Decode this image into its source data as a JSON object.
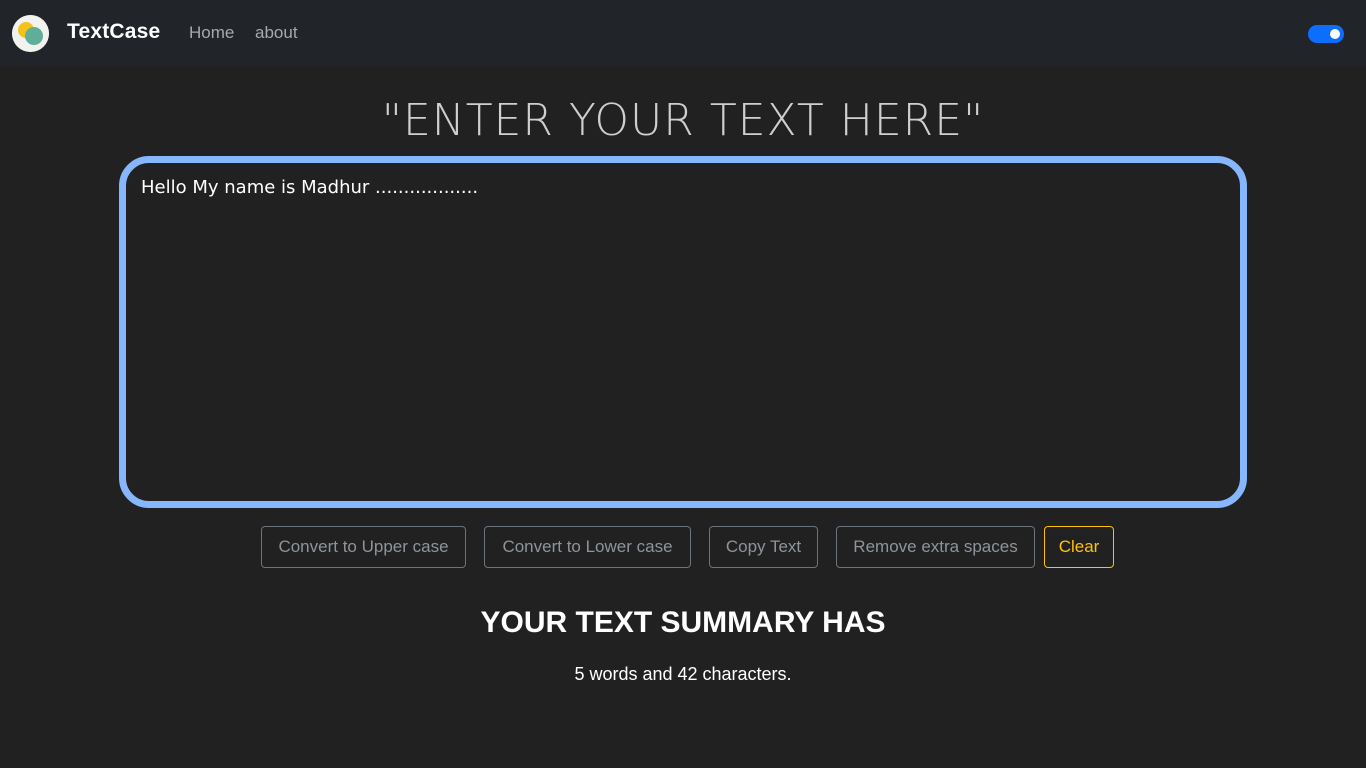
{
  "navbar": {
    "brand": "TextCase",
    "links": [
      {
        "label": "Home"
      },
      {
        "label": "about"
      }
    ],
    "dark_mode_toggle": {
      "state": "on",
      "color": "#0d6efd"
    }
  },
  "main": {
    "heading": "\"ENTER YOUR TEXT HERE\"",
    "textarea": {
      "value": "Hello My name is Madhur ..................",
      "border_color": "#86b7fe"
    },
    "buttons": {
      "upper": "Convert to Upper case",
      "lower": "Convert to Lower case",
      "copy": "Copy Text",
      "spaces": "Remove extra spaces",
      "clear": "Clear"
    },
    "summary": {
      "title": "YOUR TEXT SUMMARY HAS",
      "text": "5 words and 42 characters."
    }
  },
  "colors": {
    "background": "#212121",
    "navbar": "#212529",
    "clear_accent": "#ffc107"
  }
}
